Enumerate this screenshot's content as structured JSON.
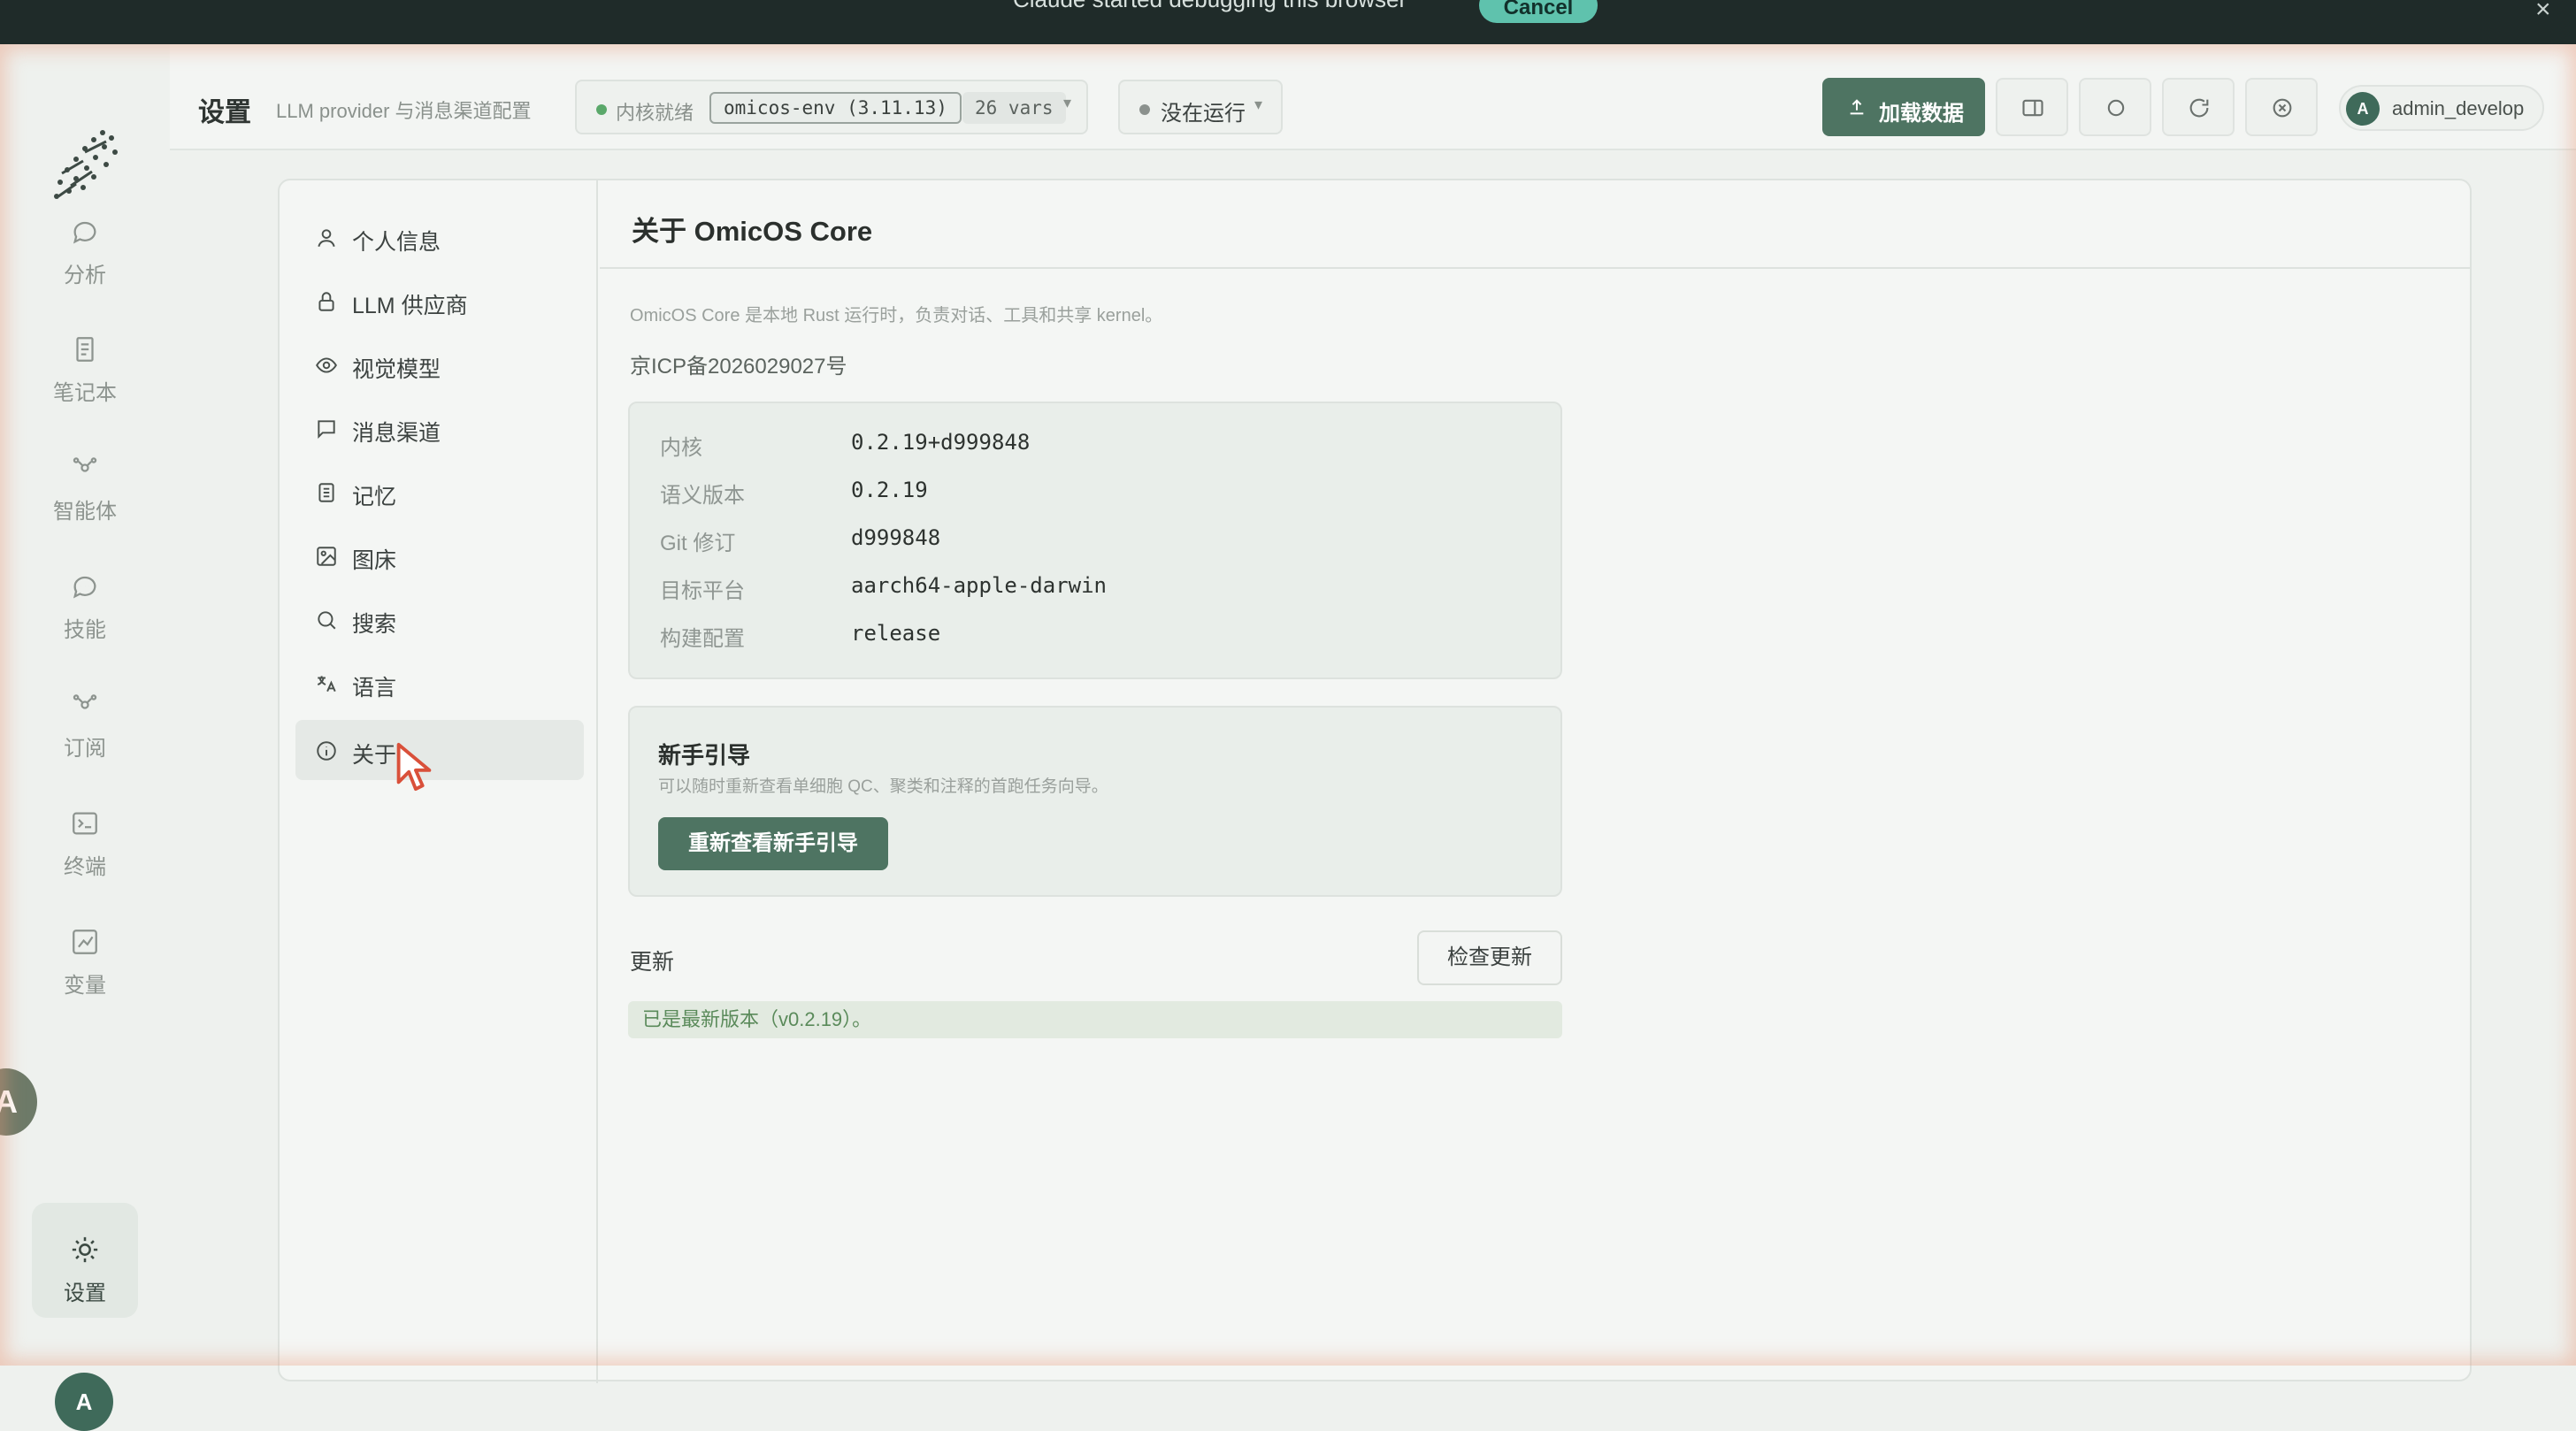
{
  "banner": {
    "text": "Claude  started debugging this browser",
    "cancel_label": "Cancel"
  },
  "rail": {
    "items": [
      {
        "label": "分析",
        "icon": "chat-bubble-icon"
      },
      {
        "label": "笔记本",
        "icon": "notebook-icon"
      },
      {
        "label": "智能体",
        "icon": "agent-network-icon"
      },
      {
        "label": "技能",
        "icon": "skill-bubble-icon"
      },
      {
        "label": "订阅",
        "icon": "subscription-node-icon"
      },
      {
        "label": "终端",
        "icon": "terminal-icon"
      },
      {
        "label": "变量",
        "icon": "variables-chart-icon"
      }
    ],
    "settings_label": "设置",
    "avatar_left_initial": "A",
    "avatar_bottom_initial": "A"
  },
  "header": {
    "title": "设置",
    "subtitle": "LLM provider 与消息渠道配置",
    "kernel": {
      "status": "内核就绪",
      "env": "omicos-env (3.11.13)",
      "vars": "26 vars"
    },
    "run_status": "没在运行",
    "load_data_label": "加载数据",
    "user": {
      "initial": "A",
      "name": "admin_develop"
    }
  },
  "settings_nav": [
    {
      "label": "个人信息",
      "icon": "user-icon"
    },
    {
      "label": "LLM 供应商",
      "icon": "lock-icon"
    },
    {
      "label": "视觉模型",
      "icon": "eye-icon"
    },
    {
      "label": "消息渠道",
      "icon": "message-square-icon"
    },
    {
      "label": "记忆",
      "icon": "memory-doc-icon"
    },
    {
      "label": "图床",
      "icon": "image-icon"
    },
    {
      "label": "搜索",
      "icon": "search-icon"
    },
    {
      "label": "语言",
      "icon": "translate-icon"
    },
    {
      "label": "关于",
      "icon": "info-icon"
    }
  ],
  "about": {
    "title": "关于 OmicOS Core",
    "description": "OmicOS Core 是本地 Rust 运行时，负责对话、工具和共享 kernel。",
    "icp": "京ICP备2026029027号",
    "info": [
      {
        "key": "内核",
        "value": "0.2.19+d999848"
      },
      {
        "key": "语义版本",
        "value": "0.2.19"
      },
      {
        "key": "Git 修订",
        "value": "d999848"
      },
      {
        "key": "目标平台",
        "value": "aarch64-apple-darwin"
      },
      {
        "key": "构建配置",
        "value": "release"
      }
    ],
    "onboarding": {
      "title": "新手引导",
      "description": "可以随时重新查看单细胞 QC、聚类和注释的首跑任务向导。",
      "button": "重新查看新手引导"
    },
    "update": {
      "label": "更新",
      "check_button": "检查更新",
      "status": "已是最新版本（v0.2.19）。"
    }
  },
  "colors": {
    "accent": "#4e7462",
    "success_text": "#5a8a5a",
    "banner_bg": "#1f2b29"
  }
}
